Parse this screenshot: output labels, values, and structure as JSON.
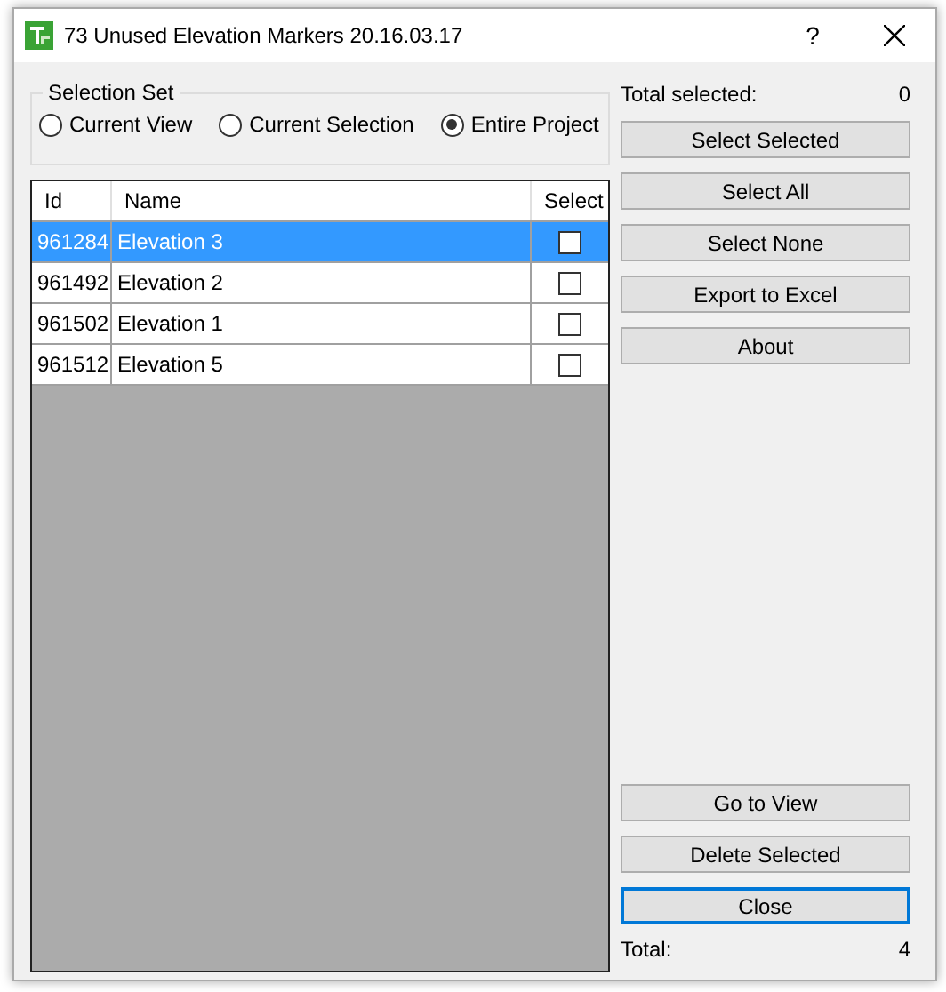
{
  "window": {
    "title": "73 Unused Elevation Markers 20.16.03.17",
    "help": "?"
  },
  "selection_set": {
    "title": "Selection Set",
    "options": [
      {
        "label": "Current View",
        "selected": false
      },
      {
        "label": "Current Selection",
        "selected": false
      },
      {
        "label": "Entire Project",
        "selected": true
      }
    ]
  },
  "table": {
    "columns": [
      "Id",
      "Name",
      "Select"
    ],
    "rows": [
      {
        "id": "961284",
        "name": "Elevation 3",
        "checked": false,
        "selected": true
      },
      {
        "id": "961492",
        "name": "Elevation 2",
        "checked": false,
        "selected": false
      },
      {
        "id": "961502",
        "name": "Elevation 1",
        "checked": false,
        "selected": false
      },
      {
        "id": "961512",
        "name": "Elevation 5",
        "checked": false,
        "selected": false
      }
    ]
  },
  "total_selected": {
    "label": "Total selected:",
    "value": "0"
  },
  "top_buttons": [
    {
      "label": "Select Selected",
      "focused": false
    },
    {
      "label": "Select All",
      "focused": false
    },
    {
      "label": "Select None",
      "focused": false
    },
    {
      "label": "Export to Excel",
      "focused": false
    },
    {
      "label": "About",
      "focused": false
    }
  ],
  "bottom_buttons": [
    {
      "label": "Go to View",
      "focused": false
    },
    {
      "label": "Delete Selected",
      "focused": false
    },
    {
      "label": "Close",
      "focused": true
    }
  ],
  "total": {
    "label": "Total:",
    "value": "4"
  }
}
